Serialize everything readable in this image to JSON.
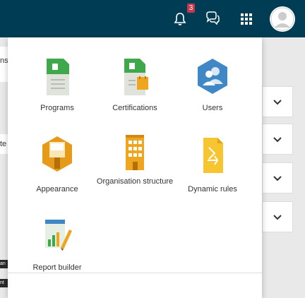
{
  "header": {
    "notification_count": "3",
    "icons": [
      "bell-icon",
      "chat-icon",
      "grid-menu-icon",
      "avatar"
    ]
  },
  "background": {
    "left_fragments": [
      "ns",
      "te"
    ],
    "dark_labels": [
      "an",
      "nt"
    ]
  },
  "menu": {
    "items": [
      {
        "label": "Programs",
        "icon": "programs-icon"
      },
      {
        "label": "Certifications",
        "icon": "certifications-icon"
      },
      {
        "label": "Users",
        "icon": "users-icon"
      },
      {
        "label": "Appearance",
        "icon": "appearance-icon"
      },
      {
        "label": "Organisation structure",
        "icon": "organisation-icon"
      },
      {
        "label": "Dynamic rules",
        "icon": "dynamic-rules-icon"
      },
      {
        "label": "Report builder",
        "icon": "report-builder-icon"
      }
    ]
  },
  "colors": {
    "topbar": "#003d55",
    "badge": "#c8374b",
    "green": "#3ea84a",
    "blue": "#3f88c5",
    "orange": "#f0a51e"
  }
}
